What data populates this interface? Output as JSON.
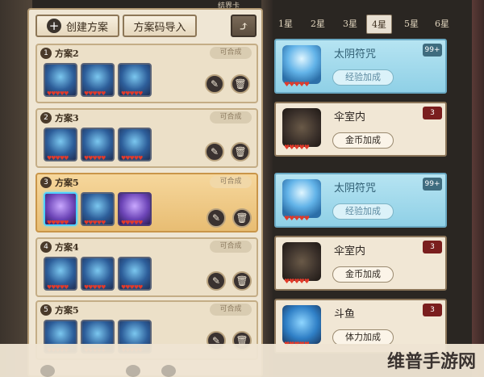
{
  "header": {
    "crumb": "结界卡"
  },
  "toolbar": {
    "create_label": "创建方案",
    "import_label": "方案码导入",
    "plus_glyph": "+",
    "share_glyph": "⤴"
  },
  "plans": [
    {
      "num": "1",
      "name": "方案2",
      "status": "可合成"
    },
    {
      "num": "2",
      "name": "方案3",
      "status": "可合成"
    },
    {
      "num": "3",
      "name": "方案5",
      "status": "可合成"
    },
    {
      "num": "4",
      "name": "方案4",
      "status": "可合成"
    },
    {
      "num": "5",
      "name": "方案5",
      "status": "可合成"
    }
  ],
  "icons": {
    "edit": "✎",
    "delete": "🗑",
    "hearts": "♥♥♥♥♥"
  },
  "star_tabs": [
    "1星",
    "2星",
    "3星",
    "4星",
    "5星",
    "6星"
  ],
  "active_star_tab": "4星",
  "souls": [
    {
      "name": "太阴符咒",
      "tag": "经验加成",
      "count": "99+"
    },
    {
      "name": "伞室内",
      "tag": "金币加成",
      "count": "3"
    },
    {
      "name": "太阴符咒",
      "tag": "经验加成",
      "count": "99+"
    },
    {
      "name": "伞室内",
      "tag": "金币加成",
      "count": "3"
    },
    {
      "name": "斗鱼",
      "tag": "体力加成",
      "count": "3"
    }
  ],
  "watermark": {
    "text": "维普手游网"
  },
  "colors": {
    "panel": "#efe6d4",
    "selected": "#e8bd73",
    "blue_card": "#8fd0e6",
    "badge_red": "#7a1e1e"
  }
}
